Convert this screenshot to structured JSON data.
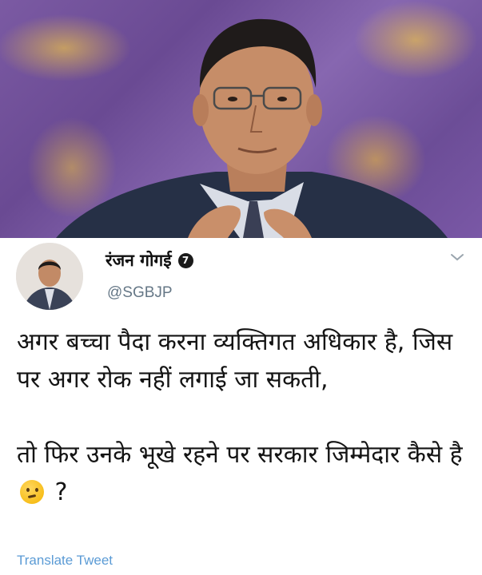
{
  "tweet": {
    "author_name": "रंजन गोगई",
    "verified_badge": "7",
    "handle": "@SGBJP",
    "text_line_1": "अगर बच्चा पैदा करना व्यक्तिगत अधिकार है, जिस पर अगर रोक नहीं लगाई जा सकती,",
    "text_line_2": "तो फिर उनके भूखे रहने पर सरकार जिम्मेदार कैसे है",
    "emoji": "thinking-face",
    "text_suffix": "?",
    "translate_label": "Translate Tweet"
  },
  "colors": {
    "background": "#ffffff",
    "handle": "#657786",
    "translate_link": "#5b9bd5",
    "photo_backdrop": "#7b5aa3"
  },
  "icons": {
    "menu": "chevron-down-icon",
    "verified": "verified-badge-icon"
  }
}
